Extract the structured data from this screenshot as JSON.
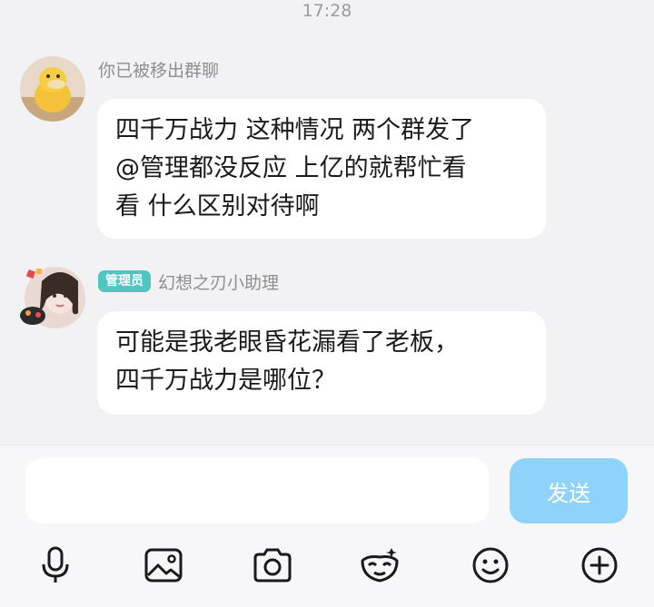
{
  "status": {
    "time": "17:28"
  },
  "messages": [
    {
      "sender_name": "你已被移出群聊",
      "text": "四千万战力 这种情况 两个群发了\n@管理都没反应  上亿的就帮忙看\n看 什么区别对待啊"
    },
    {
      "badge": "管理员",
      "sender_name": "幻想之刃小助理",
      "text": "可能是我老眼昏花漏看了老板，\n四千万战力是哪位？"
    }
  ],
  "composer": {
    "placeholder": "",
    "send_label": "发送"
  },
  "toolbar": {
    "icons": [
      "microphone-icon",
      "image-icon",
      "camera-icon",
      "sticker-icon",
      "emoji-icon",
      "plus-icon"
    ]
  },
  "colors": {
    "background": "#f2f2f4",
    "bubble": "#ffffff",
    "badge": "#4fc7c0",
    "send_button": "#8fd3fb"
  }
}
